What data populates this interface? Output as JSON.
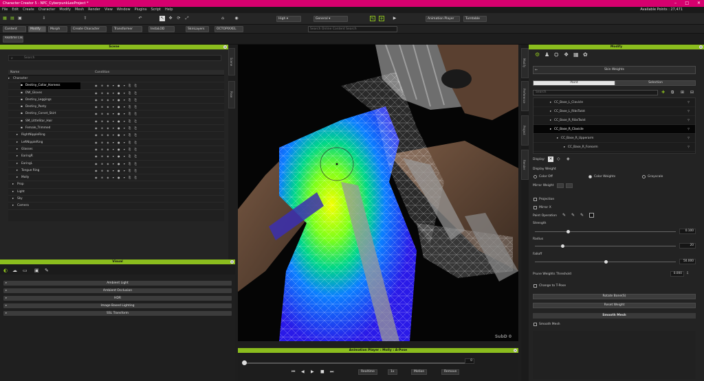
{
  "window": {
    "title": "Character Creator 5 - NPC_CyberpunkLeeProject *"
  },
  "menu": {
    "items": [
      "File",
      "Edit",
      "Create",
      "Character",
      "Modify",
      "Mesh",
      "Render",
      "View",
      "Window",
      "Plugins",
      "Script",
      "Help"
    ],
    "points_label": "Available Points : 27,471"
  },
  "toolbar": {
    "quality": "High",
    "mode": "General",
    "animation_player": "Animation Player",
    "turntable": "Turntable",
    "content": "Content",
    "modify": "Modify",
    "morph": "Morph",
    "create_character": "Create Character",
    "transformer": "Transformer",
    "insta_lod": "InstaLOD",
    "skinlayers": "SkinLayers",
    "octopus": "OCTOPIXXEL",
    "search_placeholder": "Search Online Content Search",
    "realtime_tab": "Realtime Clean"
  },
  "scene": {
    "title": "Scene",
    "search_placeholder": "Search",
    "col_name": "Name",
    "col_condition": "Condition",
    "rows": [
      {
        "label": "Character",
        "indent": 0
      },
      {
        "label": "Destiny_Collar_Harness",
        "indent": 3
      },
      {
        "label": "DW_Gloves",
        "indent": 3
      },
      {
        "label": "Destiny_Leggings",
        "indent": 3
      },
      {
        "label": "Destiny_Panty",
        "indent": 3
      },
      {
        "label": "Destiny_Corset_Skirt",
        "indent": 3
      },
      {
        "label": "SM_LittleStar_Hair",
        "indent": 3
      },
      {
        "label": "Female_Trimmed",
        "indent": 3
      },
      {
        "label": "RightNippleRing",
        "indent": 2
      },
      {
        "label": "LeftNippleRing",
        "indent": 2
      },
      {
        "label": "Glasses",
        "indent": 2
      },
      {
        "label": "EaringR",
        "indent": 2
      },
      {
        "label": "EaringL",
        "indent": 2
      },
      {
        "label": "Tongue Ring",
        "indent": 2
      },
      {
        "label": "Molly",
        "indent": 2
      },
      {
        "label": "Prop",
        "indent": 1
      },
      {
        "label": "Light",
        "indent": 1
      },
      {
        "label": "Sky",
        "indent": 1
      },
      {
        "label": "Camera",
        "indent": 1
      }
    ],
    "tabs": [
      "Scene",
      "Pose"
    ]
  },
  "visual": {
    "title": "Visual",
    "rows": [
      "Ambient Light",
      "Ambient Occlusion",
      "HDR",
      "Image Based Lighting",
      "SSL Transform"
    ]
  },
  "viewport": {
    "subd_label": "SubD 0"
  },
  "anim": {
    "title": "Animation Player : Molly : A-Pose",
    "frame": "0",
    "realtime": "Realtime",
    "speed": "1x",
    "motion": "Motion",
    "remove": "Remove"
  },
  "modify": {
    "title": "Modify",
    "skin_weights": "Skin Weights",
    "tab_paint": "Paint",
    "tab_selection": "Selection",
    "search_placeholder": "Search",
    "bones": [
      {
        "label": "CC_Base_L_Clavicle",
        "indent": 3
      },
      {
        "label": "CC_Base_L_RibsTwist",
        "indent": 3
      },
      {
        "label": "CC_Base_R_RibsTwist",
        "indent": 3
      },
      {
        "label": "CC_Base_R_Clavicle",
        "indent": 3
      },
      {
        "label": "CC_Base_R_Upperarm",
        "indent": 4
      },
      {
        "label": "CC_Base_R_Forearm",
        "indent": 5
      }
    ],
    "display_label": "Display:",
    "display_weight": "Display Weight",
    "color_off": "Color Off",
    "color_weights": "Color Weights",
    "grayscale": "Grayscale",
    "mirror_weight": "Mirror Weight",
    "projection": "Projection",
    "mirror_x": "Mirror X",
    "paint_operation": "Paint Operation",
    "strength": "Strength",
    "strength_value": "0.100",
    "radius": "Radius",
    "radius_value": "20",
    "falloff": "Falloff",
    "falloff_value": "50.000",
    "prune_threshold": "Prune Weights Threshold",
    "prune_value": "0.000",
    "change_tpose": "Change to T-Pose",
    "rotate_bones": "Rotate Bone(S)",
    "reset_weight": "Reset Weight",
    "smooth_mesh_section": "Smooth Mesh",
    "smooth_mesh": "Smooth Mesh",
    "side_tabs": [
      "Modify",
      "Preference",
      "Project",
      "Render"
    ]
  },
  "colors": {
    "accent": "#8bbd1e",
    "title": "#d6006e"
  }
}
